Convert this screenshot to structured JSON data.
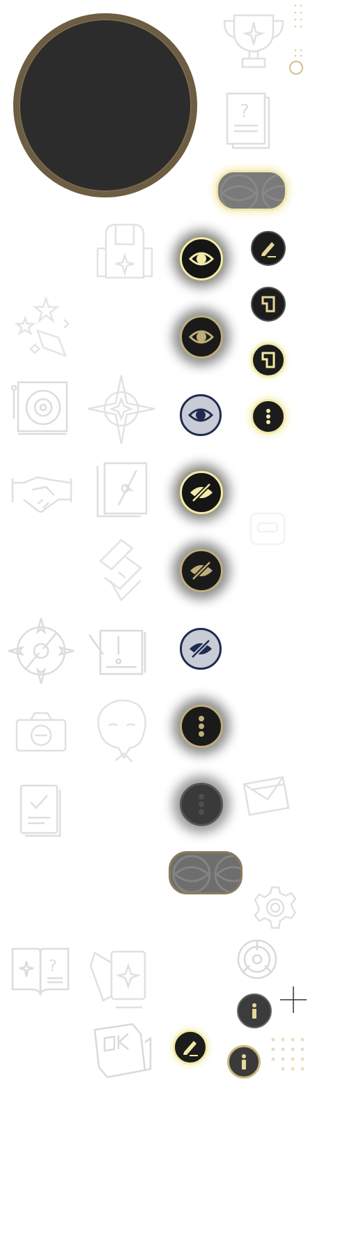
{
  "screen": {
    "background": "#ffffff"
  },
  "palette": {
    "gold": "#e6d79a",
    "gold_bright": "#f2eba8",
    "gold_muted": "#bfae7a",
    "dark": "#1c1c1c",
    "dark_gray": "#3a3a3a",
    "ring_brown": "#6d5d43",
    "navy": "#1f2a4e",
    "silver": "#c9ccd6",
    "ghost": "#e4e4e4"
  },
  "avatar": {
    "icon": "empty-avatar-circle"
  },
  "decorative_icons": [
    "trophy-icon",
    "question-document-icon",
    "backpack-icon",
    "stars-explosion-icon",
    "safe-vault-icon",
    "compass-star-icon",
    "handshake-icon",
    "book-compass-icon",
    "stacked-panels-icon",
    "compass-rose-icon",
    "alert-document-icon",
    "camera-icon",
    "character-portrait-icon",
    "checklist-icon",
    "mail-stack-icon",
    "settings-gear-icon",
    "question-book-icon",
    "star-card-icon",
    "timer-dial-icon",
    "ok-box-icon",
    "toggle-placeholder-icon",
    "crosshair-icon",
    "dot-grid-icon"
  ],
  "buttons": [
    {
      "name": "eye-button-active",
      "icon": "eye-icon",
      "state": "active"
    },
    {
      "name": "eye-button-default",
      "icon": "eye-icon",
      "state": "default"
    },
    {
      "name": "eye-button-pressed",
      "icon": "eye-icon",
      "state": "pressed"
    },
    {
      "name": "eye-off-button-active",
      "icon": "eye-off-icon",
      "state": "active"
    },
    {
      "name": "eye-off-button-default",
      "icon": "eye-off-icon",
      "state": "default"
    },
    {
      "name": "eye-off-button-pressed",
      "icon": "eye-off-icon",
      "state": "pressed"
    },
    {
      "name": "more-button-default",
      "icon": "more-vertical-icon",
      "state": "default"
    },
    {
      "name": "more-button-disabled",
      "icon": "more-vertical-icon",
      "state": "disabled"
    },
    {
      "name": "edit-button-small",
      "icon": "pencil-icon",
      "state": "default"
    },
    {
      "name": "copy-button-default",
      "icon": "page-icon",
      "state": "default"
    },
    {
      "name": "copy-button-active",
      "icon": "page-icon",
      "state": "active"
    },
    {
      "name": "more-button-small-active",
      "icon": "more-vertical-icon",
      "state": "active"
    },
    {
      "name": "info-button-dark",
      "icon": "info-icon",
      "state": "default"
    },
    {
      "name": "info-button-gold",
      "icon": "info-icon",
      "state": "alt"
    },
    {
      "name": "edit-button-gold",
      "icon": "pencil-icon",
      "state": "active"
    }
  ],
  "toggles": [
    {
      "name": "toggle-pill-highlighted",
      "state": "highlighted"
    },
    {
      "name": "toggle-pill-muted",
      "state": "default"
    }
  ]
}
